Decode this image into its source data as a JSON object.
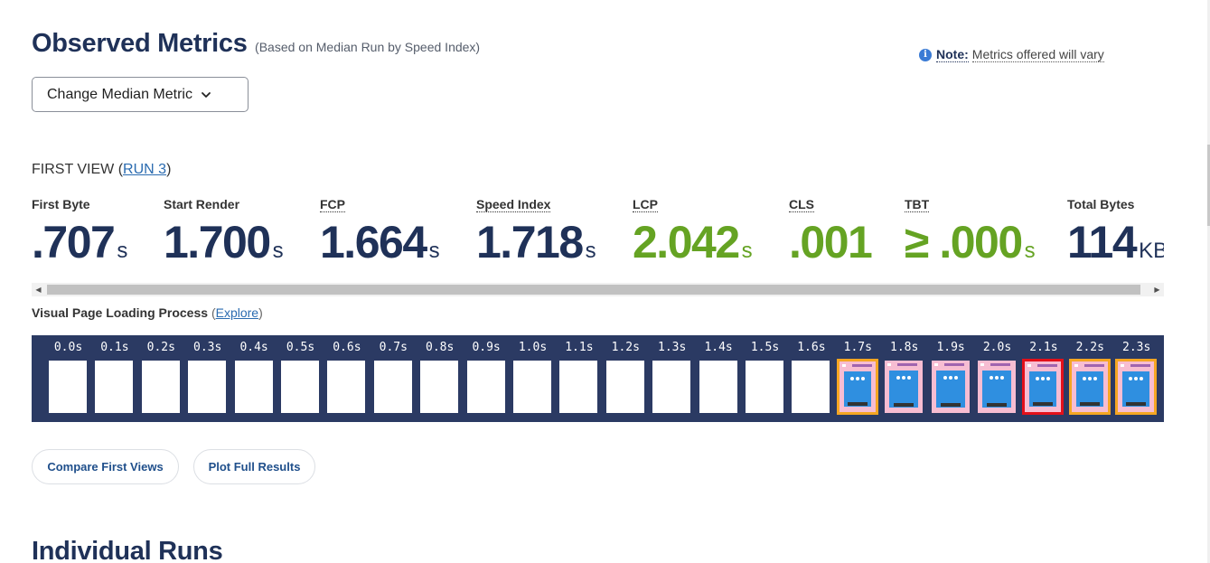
{
  "header": {
    "title": "Observed Metrics",
    "subtitle": "(Based on Median Run by Speed Index)"
  },
  "note": {
    "icon": "info-icon",
    "label": "Note:",
    "text": "Metrics offered will vary"
  },
  "median_button": {
    "label": "Change Median Metric",
    "icon": "chevron-down-icon"
  },
  "first_view": {
    "prefix": "FIRST VIEW (",
    "run_link": "RUN 3",
    "suffix": ")"
  },
  "metrics": [
    {
      "label": "First Byte",
      "value": ".707",
      "unit": "s",
      "status": "neutral"
    },
    {
      "label": "Start Render",
      "value": "1.700",
      "unit": "s",
      "status": "neutral"
    },
    {
      "label": "FCP",
      "value": "1.664",
      "unit": "s",
      "status": "neutral"
    },
    {
      "label": "Speed Index",
      "value": "1.718",
      "unit": "s",
      "status": "neutral"
    },
    {
      "label": "LCP",
      "value": "2.042",
      "unit": "s",
      "status": "good"
    },
    {
      "label": "CLS",
      "value": ".001",
      "unit": "",
      "status": "good"
    },
    {
      "label": "TBT",
      "value": "≥ .000",
      "unit": "s",
      "status": "good"
    },
    {
      "label": "Total Bytes",
      "value": "114",
      "unit": "KB",
      "status": "neutral"
    }
  ],
  "visual_loading": {
    "title": "Visual Page Loading Process",
    "open_paren": "(",
    "explore_link": "Explore",
    "close_paren": ")"
  },
  "filmstrip": {
    "frames": [
      {
        "time": "0.0s",
        "state": "blank"
      },
      {
        "time": "0.1s",
        "state": "blank"
      },
      {
        "time": "0.2s",
        "state": "blank"
      },
      {
        "time": "0.3s",
        "state": "blank"
      },
      {
        "time": "0.4s",
        "state": "blank"
      },
      {
        "time": "0.5s",
        "state": "blank"
      },
      {
        "time": "0.6s",
        "state": "blank"
      },
      {
        "time": "0.7s",
        "state": "blank"
      },
      {
        "time": "0.8s",
        "state": "blank"
      },
      {
        "time": "0.9s",
        "state": "blank"
      },
      {
        "time": "1.0s",
        "state": "blank"
      },
      {
        "time": "1.1s",
        "state": "blank"
      },
      {
        "time": "1.2s",
        "state": "blank"
      },
      {
        "time": "1.3s",
        "state": "blank"
      },
      {
        "time": "1.4s",
        "state": "blank"
      },
      {
        "time": "1.5s",
        "state": "blank"
      },
      {
        "time": "1.6s",
        "state": "blank"
      },
      {
        "time": "1.7s",
        "state": "changed"
      },
      {
        "time": "1.8s",
        "state": "rendered"
      },
      {
        "time": "1.9s",
        "state": "rendered"
      },
      {
        "time": "2.0s",
        "state": "rendered"
      },
      {
        "time": "2.1s",
        "state": "lcp"
      },
      {
        "time": "2.2s",
        "state": "changed"
      },
      {
        "time": "2.3s",
        "state": "changed"
      }
    ],
    "colors": {
      "background": "#2b3a63",
      "changed_border": "#f5a623",
      "lcp_border": "#e3101a"
    }
  },
  "buttons": {
    "compare": "Compare First Views",
    "plot": "Plot Full Results"
  },
  "individual_runs": {
    "title": "Individual Runs"
  },
  "colors": {
    "brand_dark": "#1f3158",
    "good": "#65a323",
    "link": "#2a6bb0"
  }
}
